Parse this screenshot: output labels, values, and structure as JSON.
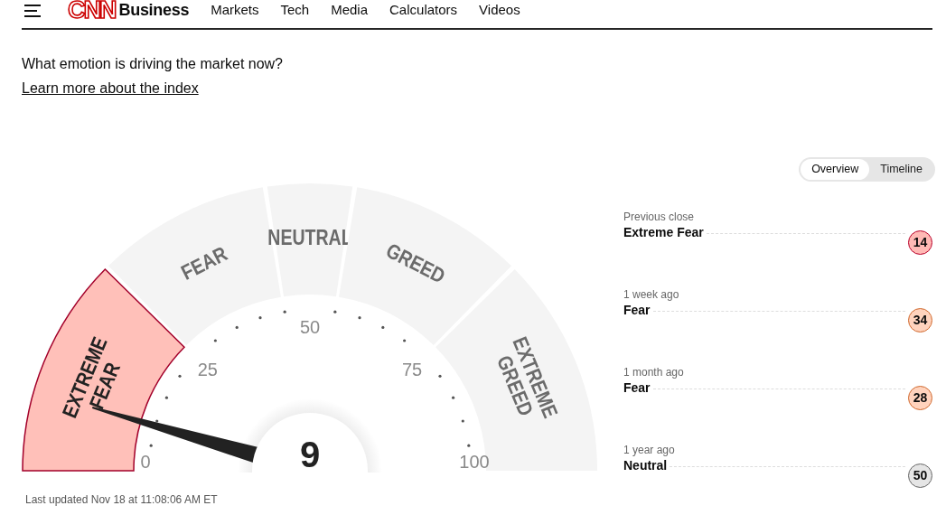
{
  "header": {
    "logo": "CNN",
    "section": "Business",
    "nav": [
      "Markets",
      "Tech",
      "Media",
      "Calculators",
      "Videos"
    ]
  },
  "intro": {
    "question": "What emotion is driving the market now?",
    "link": "Learn more about the index"
  },
  "view_toggle": [
    {
      "label": "Overview",
      "selected": true
    },
    {
      "label": "Timeline",
      "selected": false
    }
  ],
  "gauge": {
    "value": "9",
    "segments": [
      {
        "label": "EXTREME\nFEAR",
        "selected": true
      },
      {
        "label": "FEAR",
        "selected": false
      },
      {
        "label": "NEUTRAL",
        "selected": false
      },
      {
        "label": "GREED",
        "selected": false
      },
      {
        "label": "EXTREME\nGREED",
        "selected": false
      }
    ],
    "ticks": [
      "0",
      "25",
      "50",
      "75",
      "100"
    ],
    "updated": "Last updated Nov 18 at 11:08:06 AM ET"
  },
  "history": [
    {
      "period": "Previous close",
      "rating": "Extreme Fear",
      "value": "14",
      "kind": "extreme-fear"
    },
    {
      "period": "1 week ago",
      "rating": "Fear",
      "value": "34",
      "kind": "fear"
    },
    {
      "period": "1 month ago",
      "rating": "Fear",
      "value": "28",
      "kind": "fear"
    },
    {
      "period": "1 year ago",
      "rating": "Neutral",
      "value": "50",
      "kind": "neutral"
    }
  ]
}
